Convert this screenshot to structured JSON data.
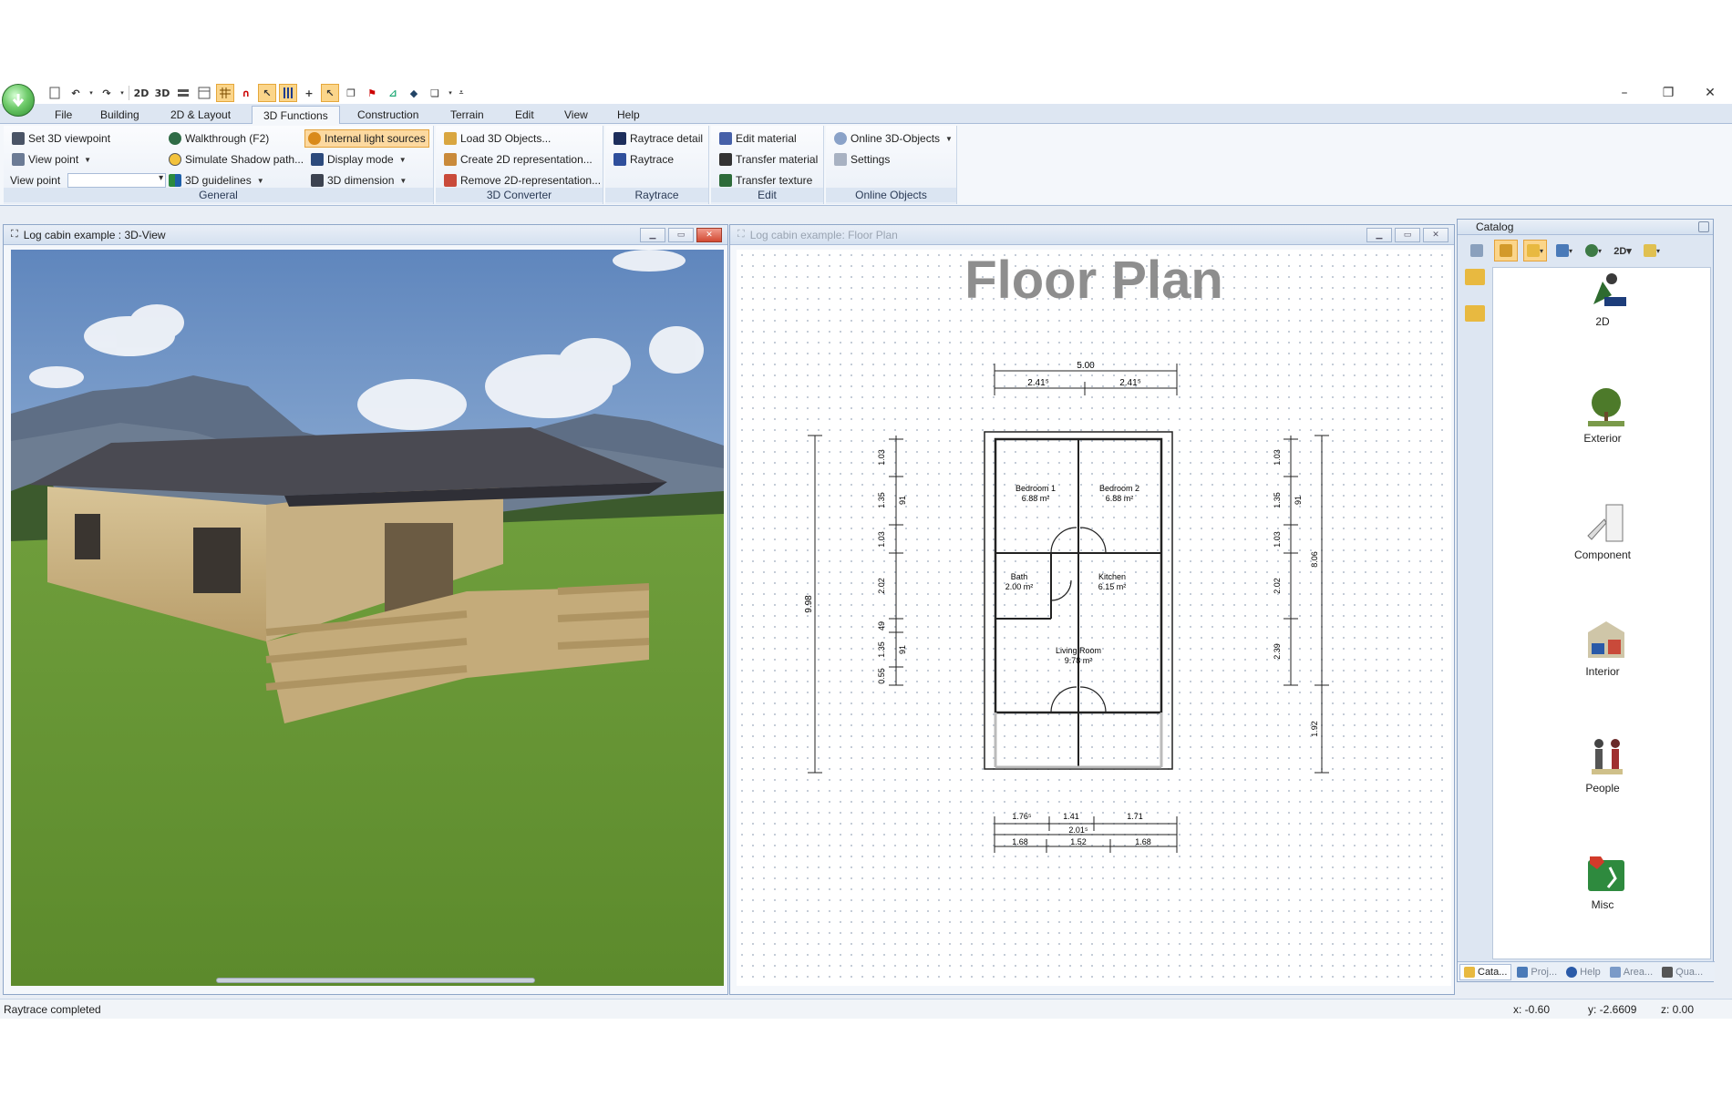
{
  "window": {
    "minimize": "–",
    "restore": "❐",
    "close": "✕"
  },
  "quick_access": {
    "btn_2d": "2D",
    "btn_3d": "3D"
  },
  "menu_tabs": [
    {
      "label": "File"
    },
    {
      "label": "Building"
    },
    {
      "label": "2D & Layout"
    },
    {
      "label": "3D Functions"
    },
    {
      "label": "Construction"
    },
    {
      "label": "Terrain"
    },
    {
      "label": "Edit"
    },
    {
      "label": "View"
    },
    {
      "label": "Help"
    }
  ],
  "ribbon": {
    "general": {
      "label": "General",
      "set_3d_viewpoint": "Set 3D viewpoint",
      "view_point_menu": "View point",
      "view_point_label": "View point",
      "walkthrough": "Walkthrough (F2)",
      "simulate_shadow": "Simulate Shadow path...",
      "guidelines_3d": "3D guidelines",
      "internal_light": "Internal light sources",
      "display_mode": "Display mode",
      "dimension_3d": "3D dimension"
    },
    "converter": {
      "label": "3D Converter",
      "load_3d": "Load 3D Objects...",
      "create_2d": "Create 2D representation...",
      "remove_2d": "Remove 2D-representation..."
    },
    "raytrace": {
      "label": "Raytrace",
      "raytrace_detail": "Raytrace detail",
      "raytrace": "Raytrace"
    },
    "edit": {
      "label": "Edit",
      "edit_material": "Edit material",
      "transfer_material": "Transfer material",
      "transfer_texture": "Transfer texture"
    },
    "online": {
      "label": "Online Objects",
      "online_3d": "Online 3D-Objects",
      "settings": "Settings"
    }
  },
  "view3d": {
    "title": "Log cabin example : 3D-View"
  },
  "floorplan": {
    "title": "Log cabin example: Floor Plan",
    "heading": "Floor Plan",
    "rooms": [
      {
        "name": "Bedroom 1",
        "area": "6.88 m²"
      },
      {
        "name": "Bedroom 2",
        "area": "6.88 m²"
      },
      {
        "name": "Bath",
        "area": "2.00 m²"
      },
      {
        "name": "Kitchen",
        "area": "6.15 m²"
      },
      {
        "name": "Living Room",
        "area": "9.78 m²"
      }
    ],
    "dims_top": {
      "total": "5.00",
      "left": "2.41⁵",
      "right": "2.41⁵"
    },
    "dims_bottom_1": [
      "1.76⁵",
      "1.41",
      "1.71"
    ],
    "dims_bottom_mid": "2.01⁵",
    "dims_bottom_2": [
      "1.68",
      "1.52",
      "1.68"
    ],
    "dims_left_outer": "9.98",
    "dims_left_inner": [
      "1.03",
      "1.35",
      "1.03",
      "2.02",
      "49",
      "1.35",
      "0.55"
    ],
    "dims_left_inner_small": [
      "91",
      "91"
    ],
    "dims_right_inner": [
      "1.03",
      "1.35",
      "1.03",
      "2.02",
      "2.39"
    ],
    "dims_right_inner_small": [
      "91"
    ],
    "dims_right_outer": [
      "8.06",
      "1.92"
    ]
  },
  "catalog": {
    "title": "Catalog",
    "items": [
      {
        "label": "2D",
        "icon": "2d-objects-icon"
      },
      {
        "label": "Exterior",
        "icon": "exterior-tree-icon"
      },
      {
        "label": "Component",
        "icon": "component-door-icon"
      },
      {
        "label": "Interior",
        "icon": "interior-room-icon"
      },
      {
        "label": "People",
        "icon": "people-icon"
      },
      {
        "label": "Misc",
        "icon": "misc-sign-icon"
      }
    ],
    "tabs": [
      {
        "label": "Cata..."
      },
      {
        "label": "Proj..."
      },
      {
        "label": "Help"
      },
      {
        "label": "Area..."
      },
      {
        "label": "Qua..."
      }
    ]
  },
  "status": {
    "message": "Raytrace completed",
    "x": "x: -0.60",
    "y": "y: -2.6609",
    "z": "z: 0.00"
  }
}
